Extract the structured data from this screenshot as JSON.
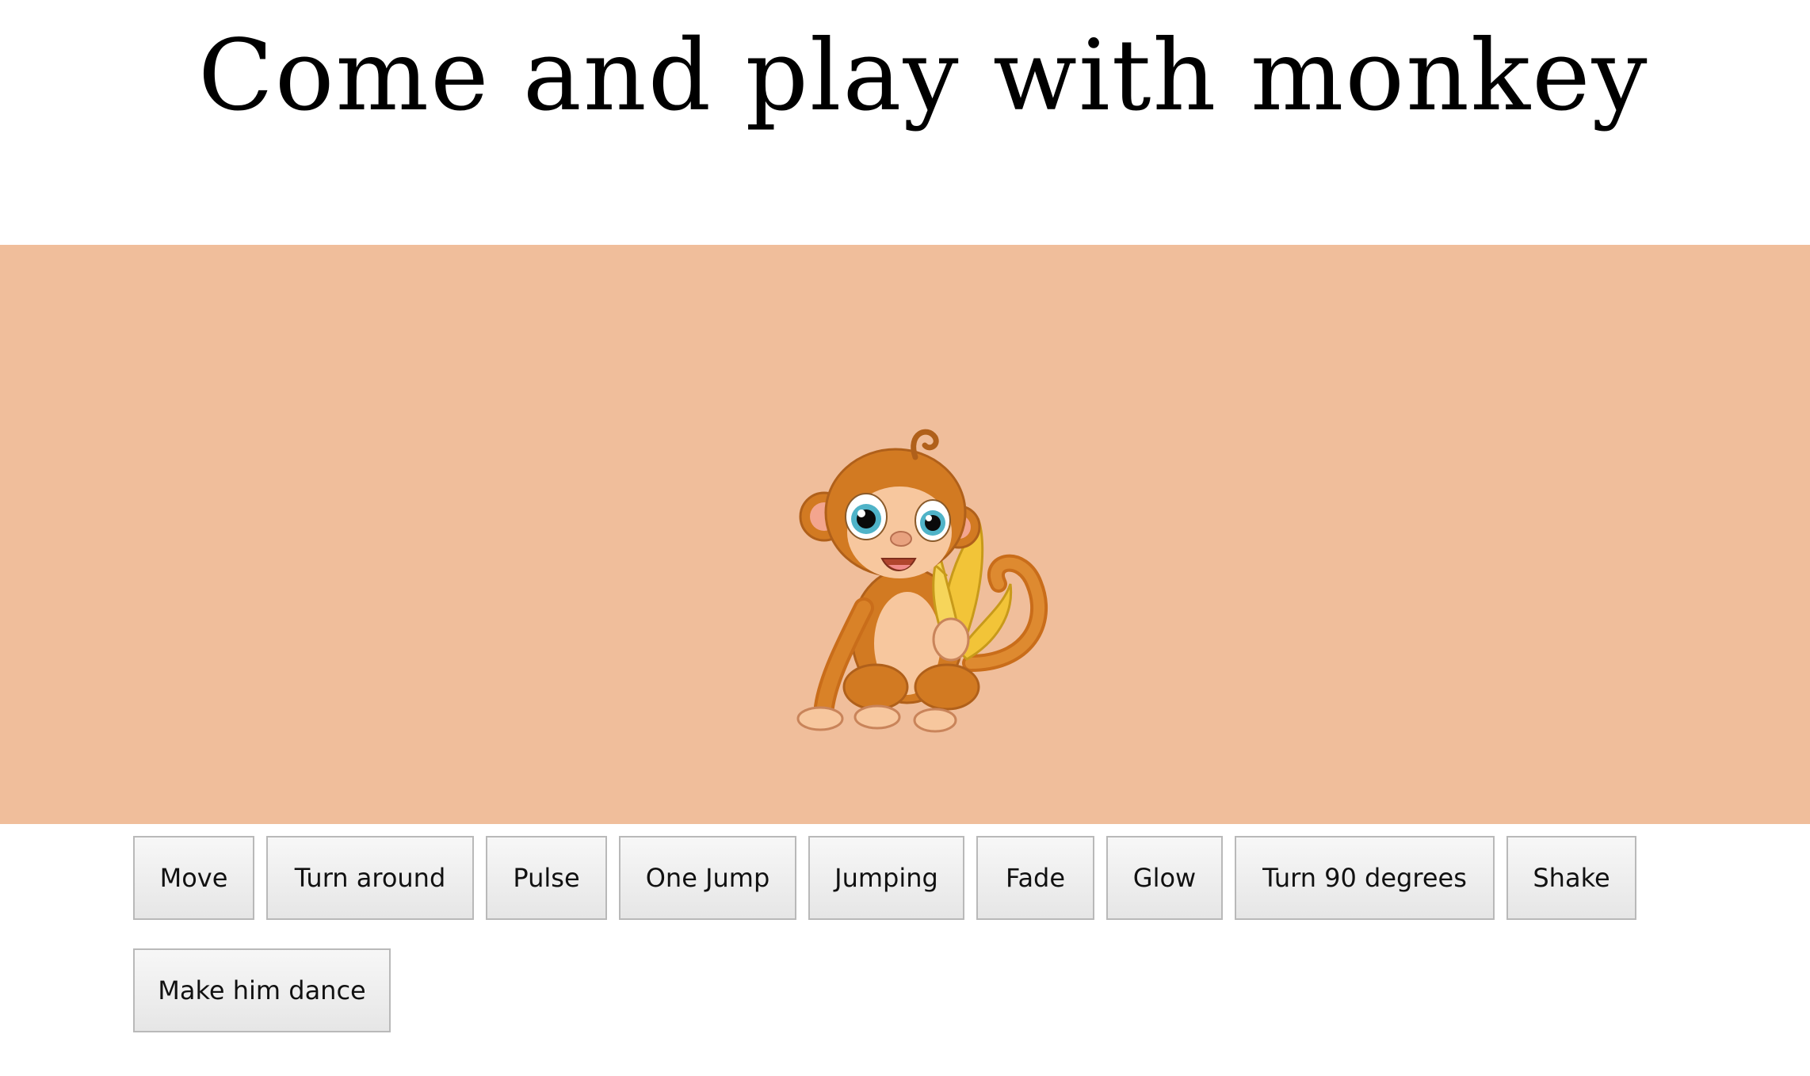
{
  "page": {
    "title": "Come and play with monkey"
  },
  "stage": {
    "background_color": "#f0be9b",
    "character": "monkey-eating-banana-image"
  },
  "buttons": {
    "row1": [
      {
        "label": "Move"
      },
      {
        "label": "Turn around"
      },
      {
        "label": "Pulse"
      },
      {
        "label": "One Jump"
      },
      {
        "label": "Jumping"
      },
      {
        "label": "Fade"
      },
      {
        "label": "Glow"
      },
      {
        "label": "Turn 90 degrees"
      },
      {
        "label": "Shake"
      }
    ],
    "row2": [
      {
        "label": "Make him dance"
      }
    ]
  },
  "colors": {
    "monkey_fur": "#d27a22",
    "monkey_belly": "#f7c79e",
    "banana": "#f2c438",
    "eye_iris": "#4fb3c8"
  }
}
